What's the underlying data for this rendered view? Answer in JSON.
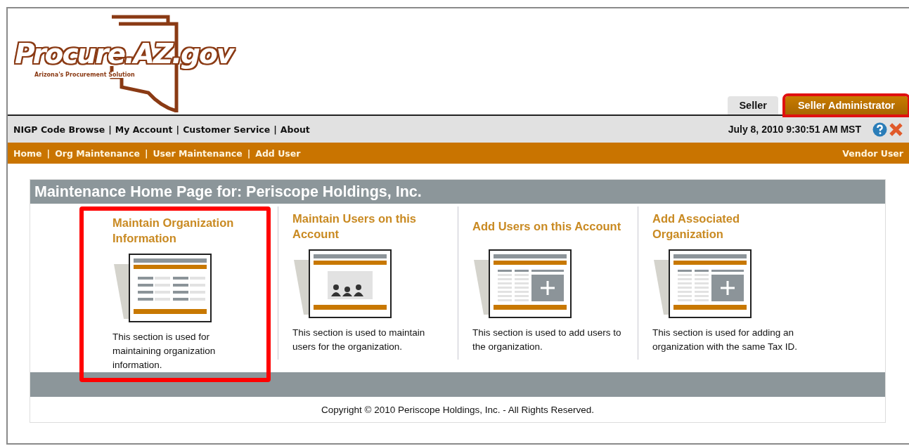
{
  "logo": {
    "name": "Procure.AZ.gov",
    "tagline": "Arizona's Procurement Solution"
  },
  "role_tabs": [
    {
      "label": "Seller",
      "selected": false,
      "highlighted": false
    },
    {
      "label": "Seller Administrator",
      "selected": true,
      "highlighted": true
    }
  ],
  "link_separator": "|",
  "top_links": [
    "NIGP Code Browse",
    "My Account",
    "Customer Service",
    "About"
  ],
  "datetime": "July 8, 2010 9:30:51 AM MST",
  "breadcrumb": [
    "Home",
    "Org Maintenance",
    "User Maintenance",
    "Add User"
  ],
  "user_type": "Vendor User",
  "panel": {
    "title": "Maintenance Home Page for: Periscope Holdings, Inc.",
    "cards": [
      {
        "kind": "list",
        "title": "Maintain Organization Information",
        "description": "This section is used for maintaining organization information.",
        "highlighted": true
      },
      {
        "kind": "people",
        "title": "Maintain Users on this Account",
        "description": "This section is used to maintain users for the organization.",
        "highlighted": false
      },
      {
        "kind": "add",
        "title": "Add Users on this Account",
        "description": "This section is used to add users to the organization.",
        "highlighted": false
      },
      {
        "kind": "add",
        "title": "Add Associated Organization",
        "description": "This section is used for adding an organization with the same Tax ID.",
        "highlighted": false
      }
    ]
  },
  "copyright": "Copyright © 2010 Periscope Holdings, Inc. - All Rights Reserved."
}
